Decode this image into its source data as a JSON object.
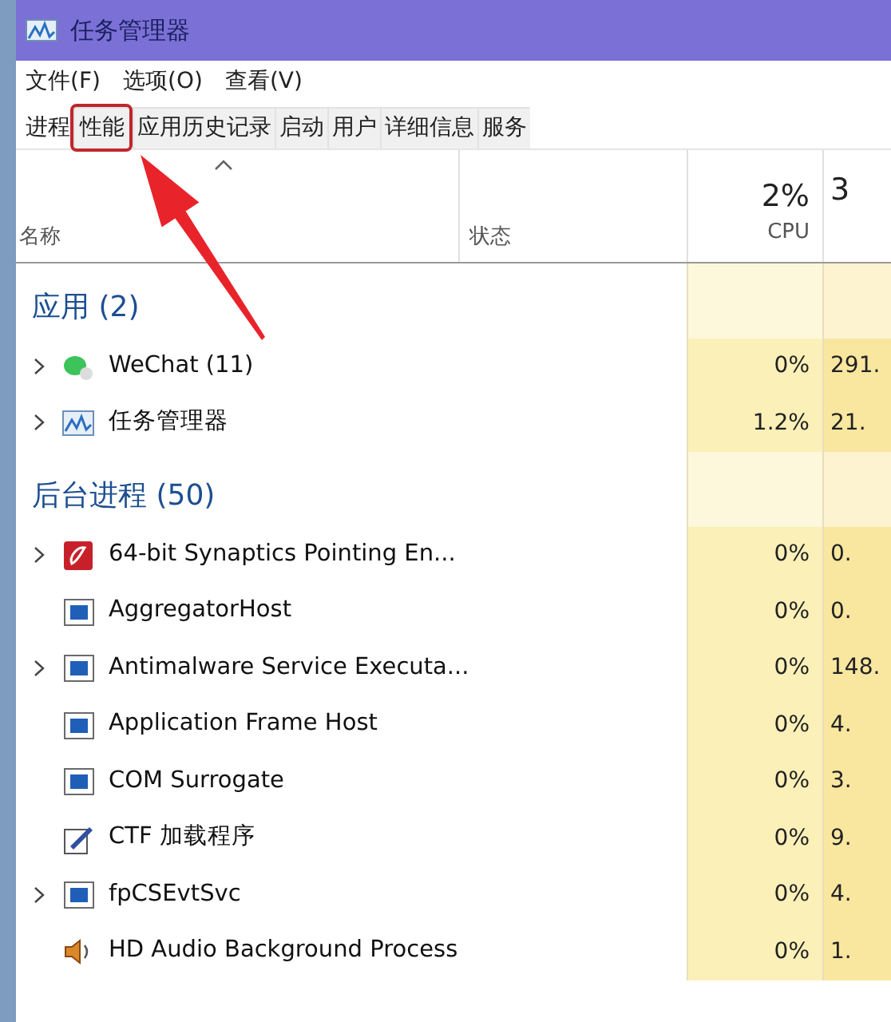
{
  "window": {
    "title": "任务管理器"
  },
  "menu": [
    "文件(F)",
    "选项(O)",
    "查看(V)"
  ],
  "tabs": [
    {
      "label": "进程",
      "selected": true,
      "highlighted": false
    },
    {
      "label": "性能",
      "selected": false,
      "highlighted": true
    },
    {
      "label": "应用历史记录",
      "selected": false,
      "highlighted": false
    },
    {
      "label": "启动",
      "selected": false,
      "highlighted": false
    },
    {
      "label": "用户",
      "selected": false,
      "highlighted": false
    },
    {
      "label": "详细信息",
      "selected": false,
      "highlighted": false
    },
    {
      "label": "服务",
      "selected": false,
      "highlighted": false
    }
  ],
  "table": {
    "columns": [
      {
        "label": "名称"
      },
      {
        "label": "状态"
      },
      {
        "usage": "2%",
        "label": "CPU"
      },
      {
        "usage": "3"
      }
    ],
    "rows": [
      {
        "kind": "group",
        "name": "应用 (2)"
      },
      {
        "kind": "wechat",
        "expandable": true,
        "name": "WeChat (11)",
        "cpu": "0%",
        "column_4": "291."
      },
      {
        "kind": "taskmgr",
        "expandable": true,
        "name": "任务管理器",
        "cpu": "1.2%",
        "column_4": "21."
      },
      {
        "kind": "group",
        "name": "后台进程 (50)"
      },
      {
        "kind": "synaptics",
        "expandable": true,
        "name": "64-bit Synaptics Pointing En...",
        "cpu": "0%",
        "column_4": "0."
      },
      {
        "kind": "app",
        "expandable": false,
        "name": "AggregatorHost",
        "cpu": "0%",
        "column_4": "0."
      },
      {
        "kind": "app",
        "expandable": true,
        "name": "Antimalware Service Executa...",
        "cpu": "0%",
        "column_4": "148."
      },
      {
        "kind": "app",
        "expandable": false,
        "name": "Application Frame Host",
        "cpu": "0%",
        "column_4": "4."
      },
      {
        "kind": "app",
        "expandable": false,
        "name": "COM Surrogate",
        "cpu": "0%",
        "column_4": "3."
      },
      {
        "kind": "ctf",
        "expandable": false,
        "name": "CTF 加载程序",
        "cpu": "0%",
        "column_4": "9."
      },
      {
        "kind": "app",
        "expandable": true,
        "name": "fpCSEvtSvc",
        "cpu": "0%",
        "column_4": "4."
      },
      {
        "kind": "audio",
        "expandable": false,
        "name": "HD Audio Background Process",
        "cpu": "0%",
        "column_4": "1."
      }
    ]
  }
}
